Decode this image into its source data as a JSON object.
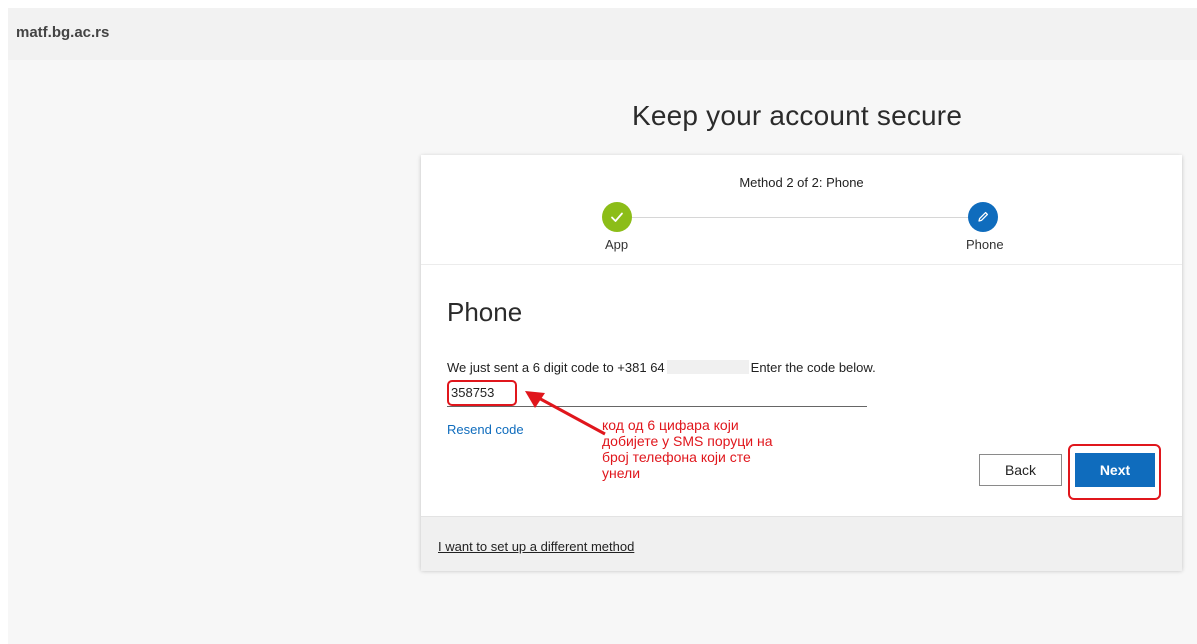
{
  "header": {
    "org_name": "matf.bg.ac.rs"
  },
  "page": {
    "title": "Keep your account secure"
  },
  "stepper": {
    "method_label": "Method 2 of 2: Phone",
    "steps": [
      {
        "label": "App",
        "status": "completed",
        "icon": "check-icon",
        "color": "#8cbd18"
      },
      {
        "label": "Phone",
        "status": "current",
        "icon": "pencil-icon",
        "color": "#0f6cbd"
      }
    ]
  },
  "phone_section": {
    "title": "Phone",
    "instruction_prefix": "We just sent a 6 digit code to +381 64",
    "instruction_suffix": "Enter the code below.",
    "code_value": "358753",
    "resend_label": "Resend code"
  },
  "annotation": {
    "text": "код од 6 цифара који добијете у SMS поруци на број телефона који сте унели",
    "color": "#e0161c"
  },
  "buttons": {
    "back": "Back",
    "next": "Next"
  },
  "footer": {
    "different_method_link": "I want to set up a different method"
  },
  "colors": {
    "accent": "#0f6cbd",
    "success": "#8cbd18",
    "annotation": "#e0161c"
  }
}
